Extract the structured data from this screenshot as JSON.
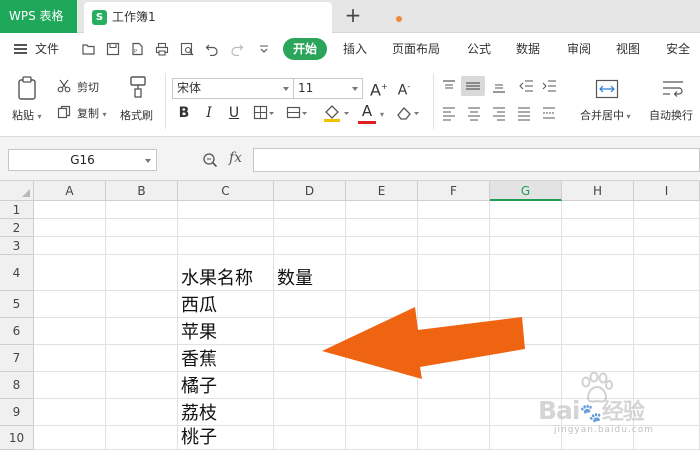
{
  "titlebar": {
    "app_name": "WPS 表格",
    "doc_tab": "工作簿1",
    "doc_icon_letter": "S",
    "new_tab": "+"
  },
  "menubar": {
    "file_label": "文件",
    "tabs": [
      "开始",
      "插入",
      "页面布局",
      "公式",
      "数据",
      "审阅",
      "视图",
      "安全"
    ]
  },
  "ribbon": {
    "paste_label": "粘贴",
    "cut_label": "剪切",
    "copy_label": "复制",
    "format_painter_label": "格式刷",
    "font_name": "宋体",
    "font_size": "11",
    "grow_label": "A",
    "shrink_label": "A",
    "bold": "B",
    "italic": "I",
    "underline": "U",
    "font_color_letter": "A",
    "merge_label": "合并居中",
    "wrap_label": "自动换行"
  },
  "formula_bar": {
    "name_box": "G16",
    "fx": "fx",
    "formula": ""
  },
  "grid": {
    "columns": [
      "A",
      "B",
      "C",
      "D",
      "E",
      "F",
      "G",
      "H",
      "I"
    ],
    "selected_column": "G",
    "rows": [
      "1",
      "2",
      "3",
      "4",
      "5",
      "6",
      "7",
      "8",
      "9",
      "10"
    ],
    "cells": {
      "C4": "水果名称",
      "D4": "数量",
      "C5": "西瓜",
      "C6": "苹果",
      "C7": "香蕉",
      "C8": "橘子",
      "C9": "荔枝",
      "C10": "桃子"
    }
  },
  "annotation": {
    "arrow_color": "#ef6411"
  },
  "colors": {
    "accent_green": "#2aa55a",
    "tab_bar": "#e6e6e6"
  },
  "watermark": {
    "brand": "Bai",
    "brand_cn": "经验",
    "url": "jingyan.baidu.com"
  }
}
